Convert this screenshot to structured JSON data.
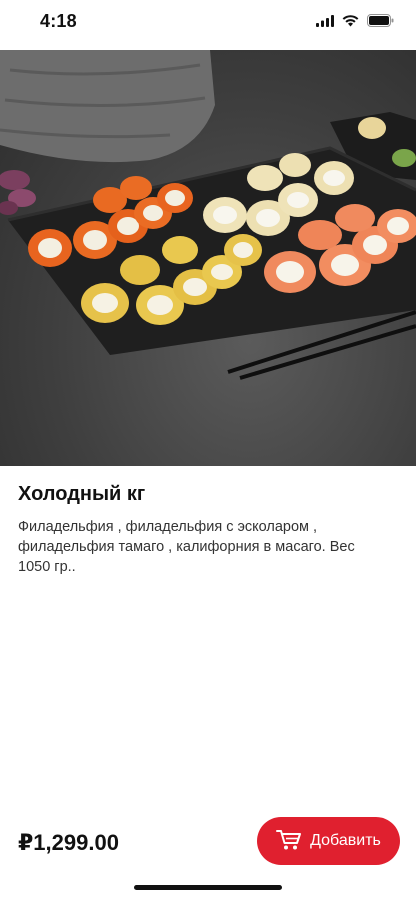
{
  "status_bar": {
    "time": "4:18",
    "icons": [
      "signal-icon",
      "wifi-icon",
      "battery-icon"
    ]
  },
  "hero_image": {
    "subject": "sushi-rolls-platter"
  },
  "product": {
    "title": "Холодный кг",
    "description": "Филадельфия , филадельфия с эсколаром , филадельфия тамаго , калифорния в масаго.  Вес 1050 гр..",
    "price": "₽1,299.00"
  },
  "actions": {
    "add_label": "Добавить",
    "add_icon": "cart-icon"
  },
  "colors": {
    "accent": "#e0202f",
    "text": "#111111"
  }
}
